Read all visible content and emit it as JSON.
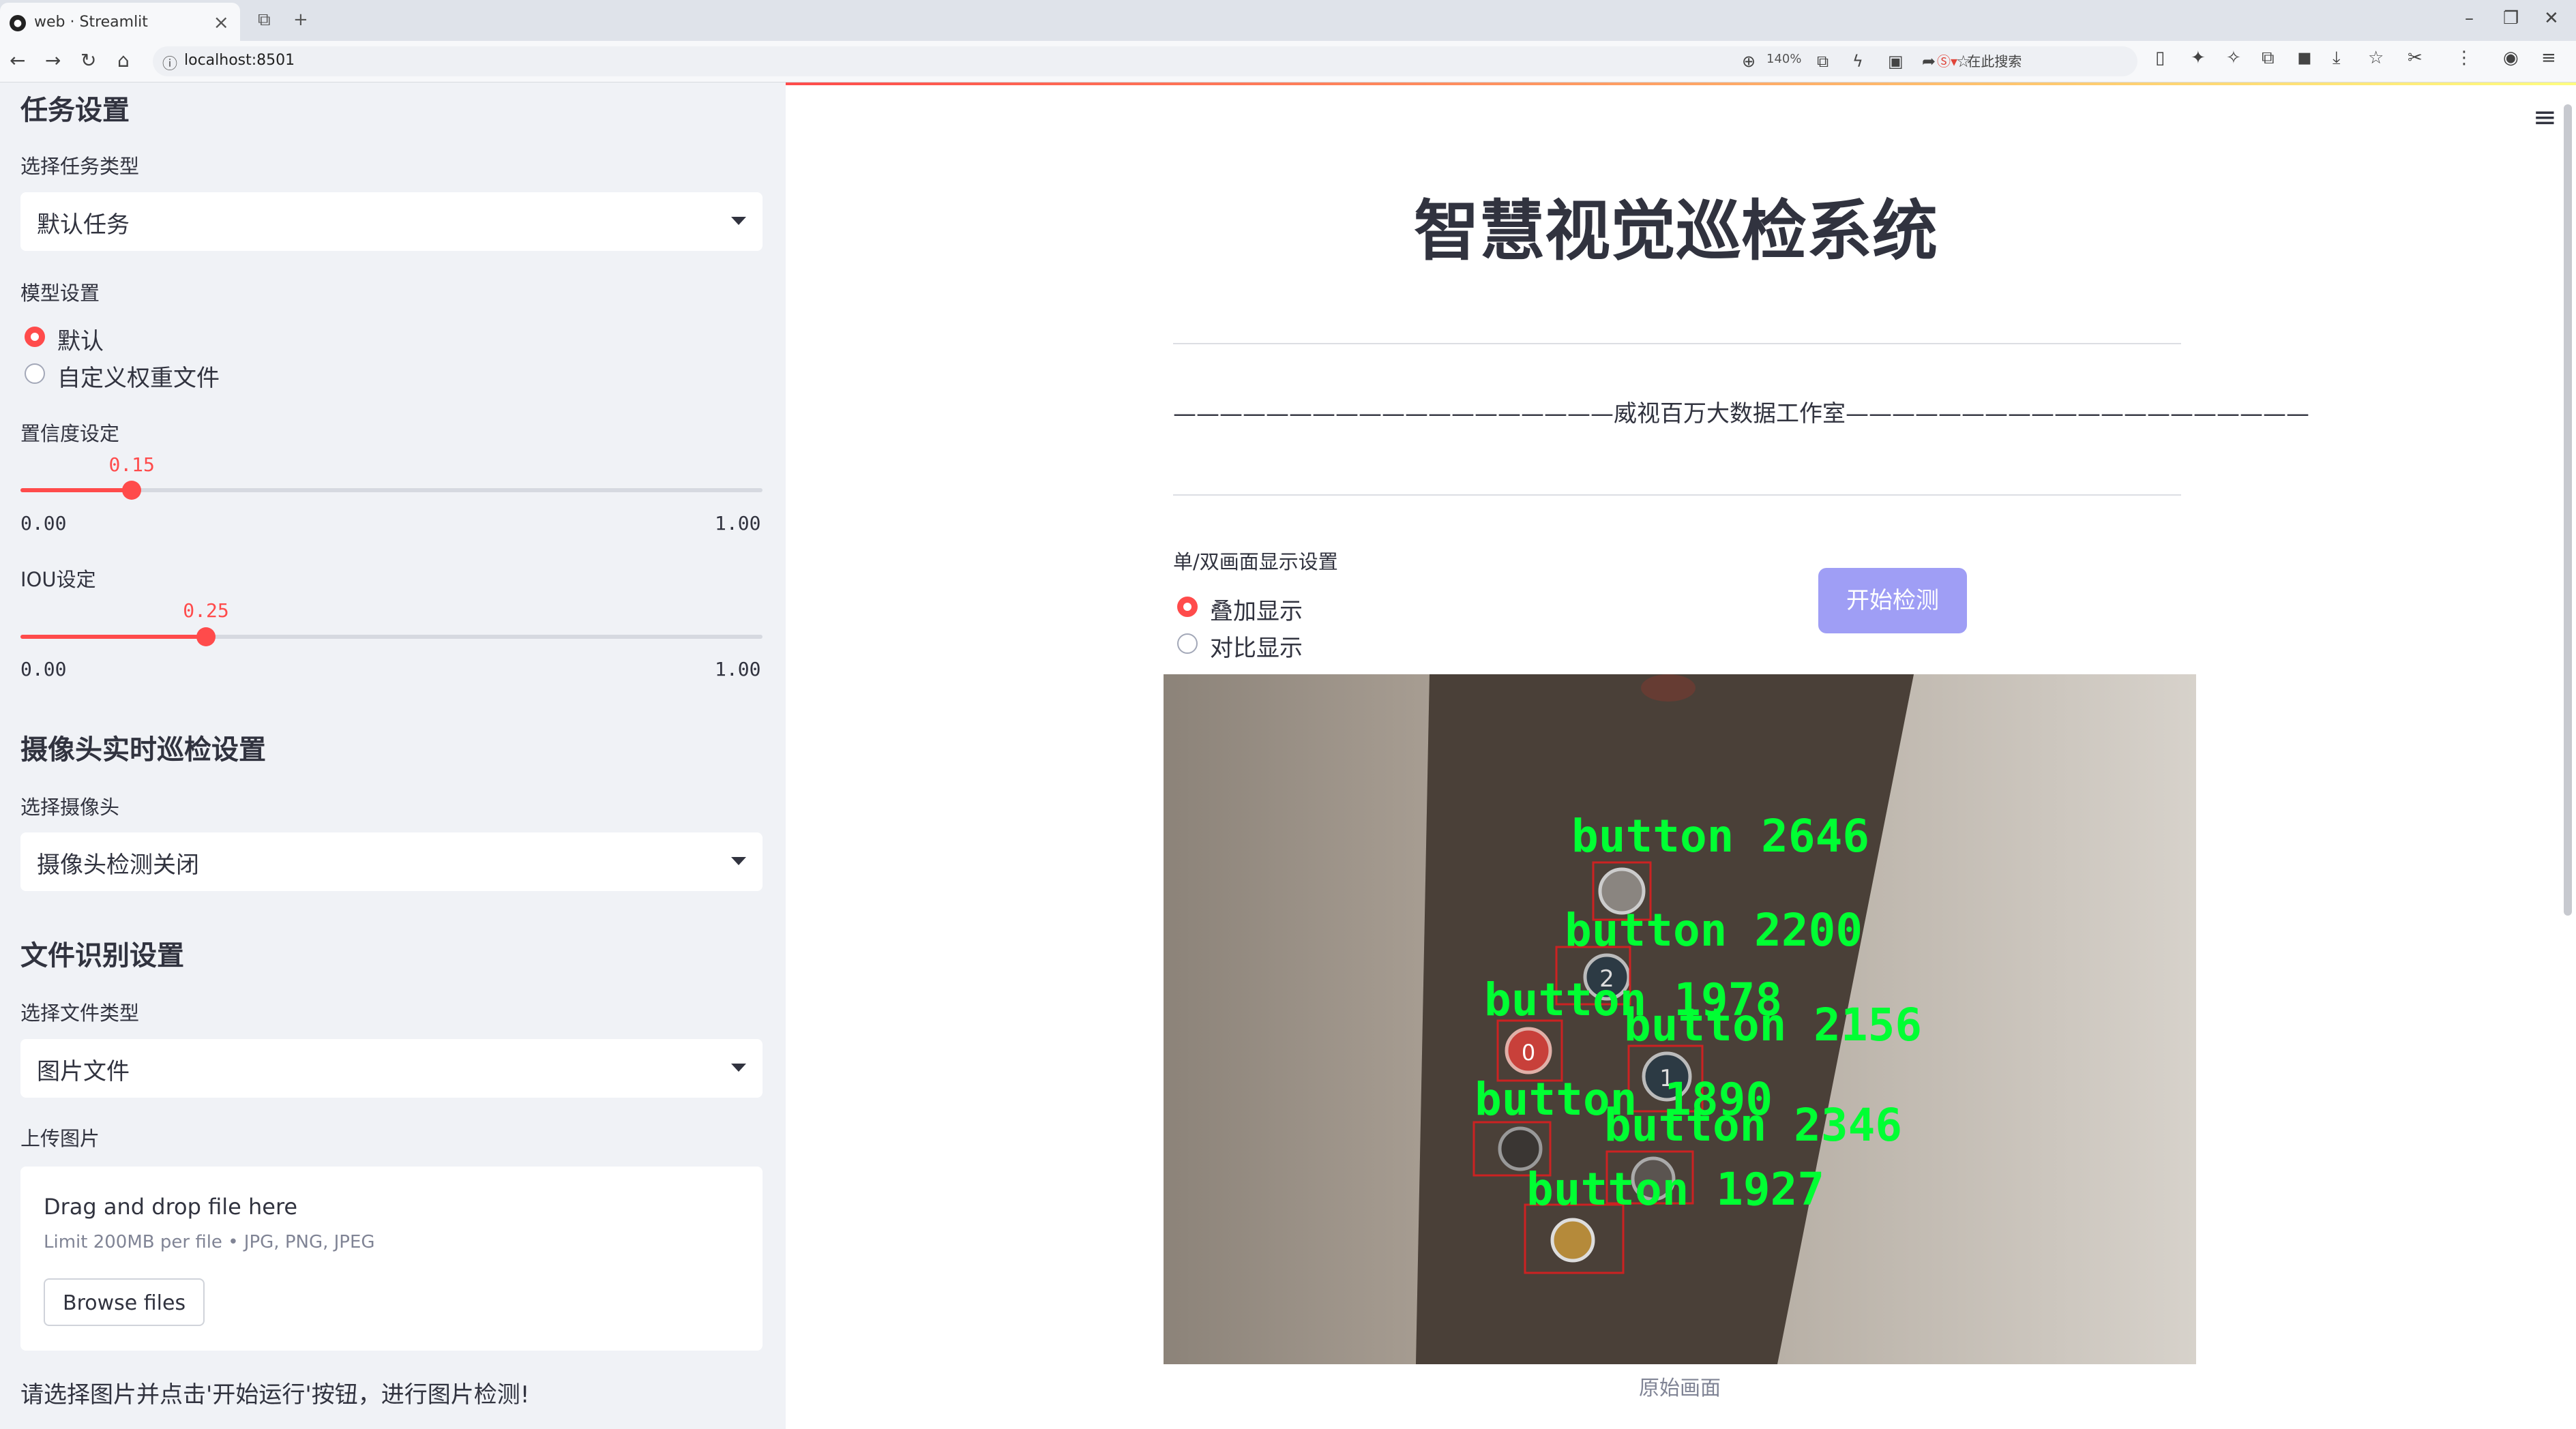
{
  "browser": {
    "tab_title": "web · Streamlit",
    "url": "localhost:8501",
    "zoom": "140%",
    "search_label": "在此搜索"
  },
  "sidebar": {
    "task_header": "任务设置",
    "task_type_label": "选择任务类型",
    "task_type_value": "默认任务",
    "model_label": "模型设置",
    "model_options": [
      "默认",
      "自定义权重文件"
    ],
    "model_selected": 0,
    "confidence_label": "置信度设定",
    "confidence": {
      "value": "0.15",
      "min": "0.00",
      "max": "1.00",
      "fraction": 0.15
    },
    "iou_label": "IOU设定",
    "iou": {
      "value": "0.25",
      "min": "0.00",
      "max": "1.00",
      "fraction": 0.25
    },
    "camera_header": "摄像头实时巡检设置",
    "camera_label": "选择摄像头",
    "camera_value": "摄像头检测关闭",
    "file_header": "文件识别设置",
    "file_type_label": "选择文件类型",
    "file_type_value": "图片文件",
    "upload_label": "上传图片",
    "uploader": {
      "drag_text": "Drag and drop file here",
      "limit_text": "Limit 200MB per file • JPG, PNG, JPEG",
      "browse_label": "Browse files"
    },
    "note": "请选择图片并点击'开始运行'按钮，进行图片检测!"
  },
  "main": {
    "title": "智慧视觉巡检系统",
    "subtitle": "———————————————————威视百万大数据工作室————————————————————",
    "display_label": "单/双画面显示设置",
    "display_options": [
      "叠加显示",
      "对比显示"
    ],
    "display_selected": 0,
    "start_button": "开始检测",
    "image_caption": "原始画面",
    "detections": [
      {
        "label": "button 2646"
      },
      {
        "label": "button 2200"
      },
      {
        "label": "button 1978"
      },
      {
        "label": "button 2156"
      },
      {
        "label": "button 1890"
      },
      {
        "label": "button 2346"
      },
      {
        "label": "button 1927"
      }
    ],
    "colors": {
      "accent": "#ff4b4b",
      "button": "#9f9ef5",
      "detection_text": "#00ff33",
      "box": "#cc2222"
    }
  }
}
